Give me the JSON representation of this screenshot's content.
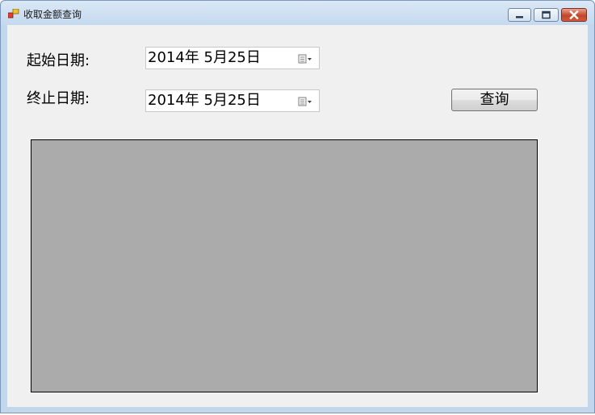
{
  "window": {
    "title": "收取金额查询"
  },
  "form": {
    "start_label": "起始日期:",
    "start_value": "2014年  5月25日",
    "end_label": "终止日期:",
    "end_value": "2014年  5月25日",
    "query_label": "查询"
  },
  "icons": {
    "app": "app-icon",
    "minimize": "minimize-icon",
    "maximize": "maximize-icon",
    "close": "close-icon",
    "calendar": "calendar-dropdown-icon"
  },
  "colors": {
    "client_bg": "#f0f0f0",
    "panel_bg": "#ababab",
    "close_button": "#c2452a"
  }
}
